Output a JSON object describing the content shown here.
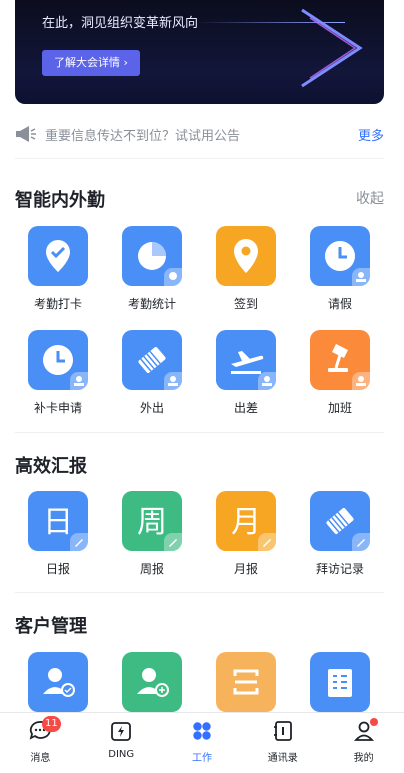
{
  "banner": {
    "text": "在此，洞见组织变革新风向",
    "button": "了解大会详情 ›"
  },
  "notice": {
    "text": "重要信息传达不到位？试试用公告",
    "more": "更多"
  },
  "section1": {
    "title": "智能内外勤",
    "action": "收起",
    "items": [
      {
        "label": "考勤打卡",
        "icon": "check-pin-icon"
      },
      {
        "label": "考勤统计",
        "icon": "pie-chart-icon"
      },
      {
        "label": "签到",
        "icon": "location-pin-icon"
      },
      {
        "label": "请假",
        "icon": "clock-icon"
      },
      {
        "label": "补卡申请",
        "icon": "clock-icon"
      },
      {
        "label": "外出",
        "icon": "stamp-icon"
      },
      {
        "label": "出差",
        "icon": "airplane-icon"
      },
      {
        "label": "加班",
        "icon": "desk-lamp-icon"
      }
    ]
  },
  "section2": {
    "title": "高效汇报",
    "items": [
      {
        "label": "日报",
        "glyph": "日"
      },
      {
        "label": "周报",
        "glyph": "周"
      },
      {
        "label": "月报",
        "glyph": "月"
      },
      {
        "label": "拜访记录",
        "icon": "stamp-icon"
      }
    ]
  },
  "section3": {
    "title": "客户管理"
  },
  "tabbar": {
    "tabs": [
      {
        "label": "消息",
        "badge": "11"
      },
      {
        "label": "DING"
      },
      {
        "label": "工作"
      },
      {
        "label": "通讯录"
      },
      {
        "label": "我的"
      }
    ]
  },
  "colors": {
    "accent": "#3370ff",
    "tile_blue": "#4a8ff5",
    "tile_orange": "#f6a623",
    "tile_green": "#3dbb83",
    "badge_red": "#f54a45"
  }
}
